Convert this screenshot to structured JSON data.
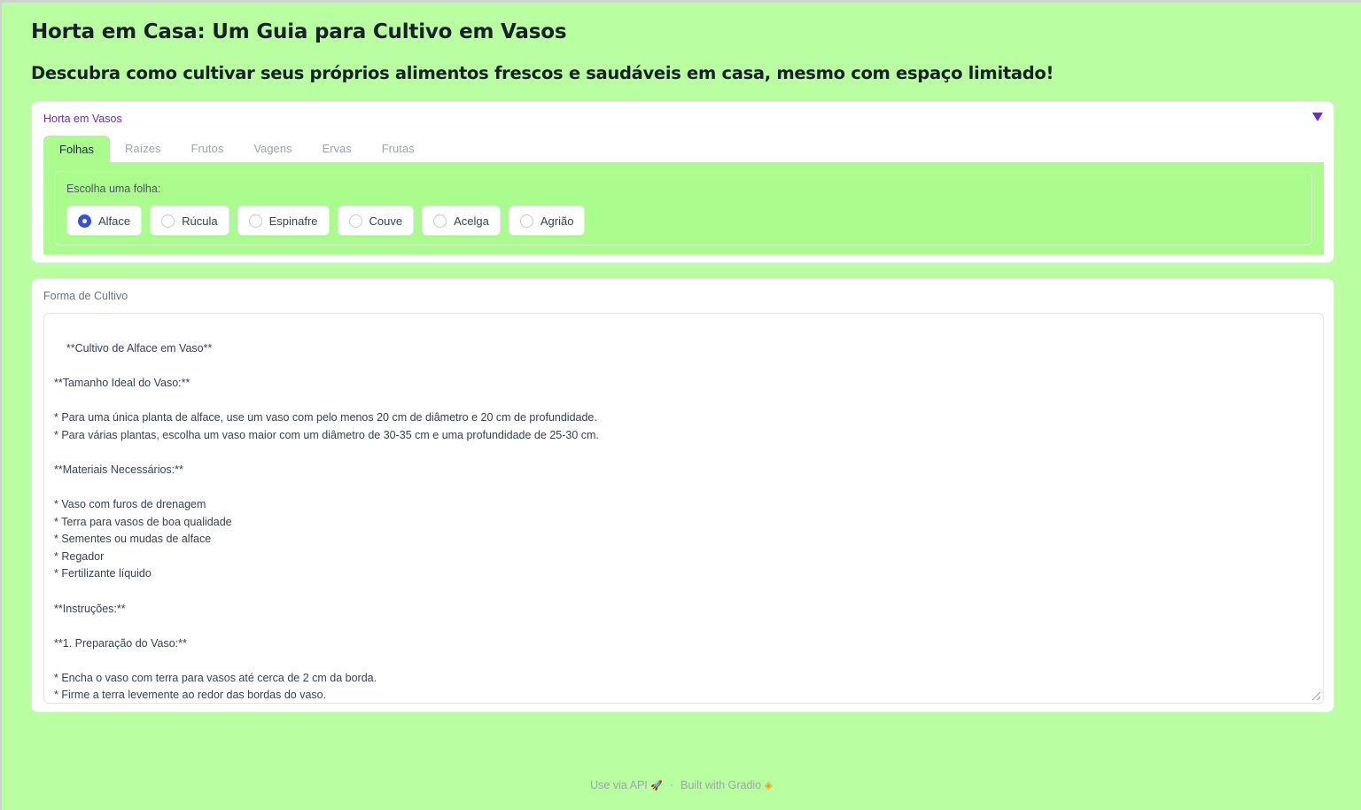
{
  "header": {
    "title": "Horta em Casa: Um Guia para Cultivo em Vasos",
    "subtitle": "Descubra como cultivar seus próprios alimentos frescos e saudáveis em casa, mesmo com espaço limitado!"
  },
  "accordion": {
    "label": "Horta em Vasos",
    "tabs": [
      {
        "label": "Folhas",
        "active": true
      },
      {
        "label": "Raízes",
        "active": false
      },
      {
        "label": "Frutos",
        "active": false
      },
      {
        "label": "Vagens",
        "active": false
      },
      {
        "label": "Ervas",
        "active": false
      },
      {
        "label": "Frutas",
        "active": false
      }
    ],
    "radio_group": {
      "label": "Escolha uma folha:",
      "options": [
        "Alface",
        "Rúcula",
        "Espinafre",
        "Couve",
        "Acelga",
        "Agrião"
      ],
      "selected": "Alface"
    }
  },
  "output": {
    "label": "Forma de Cultivo",
    "text": "**Cultivo de Alface em Vaso**\n\n**Tamanho Ideal do Vaso:**\n\n* Para uma única planta de alface, use um vaso com pelo menos 20 cm de diâmetro e 20 cm de profundidade.\n* Para várias plantas, escolha um vaso maior com um diâmetro de 30-35 cm e uma profundidade de 25-30 cm.\n\n**Materiais Necessários:**\n\n* Vaso com furos de drenagem\n* Terra para vasos de boa qualidade\n* Sementes ou mudas de alface\n* Regador\n* Fertilizante líquido\n\n**Instruções:**\n\n**1. Preparação do Vaso:**\n\n* Encha o vaso com terra para vasos até cerca de 2 cm da borda.\n* Firme a terra levemente ao redor das bordas do vaso."
  },
  "footer": {
    "api_label": "Use via API",
    "separator": "·",
    "built_label": "Built with Gradio",
    "api_icon": "rocket-icon",
    "gradio_icon": "gradio-logo-icon"
  },
  "colors": {
    "background": "#b9fea1",
    "tab_active_bg": "#aafd8d",
    "accent": "#6d28d9",
    "radio_checked": "#3b4fd6"
  }
}
